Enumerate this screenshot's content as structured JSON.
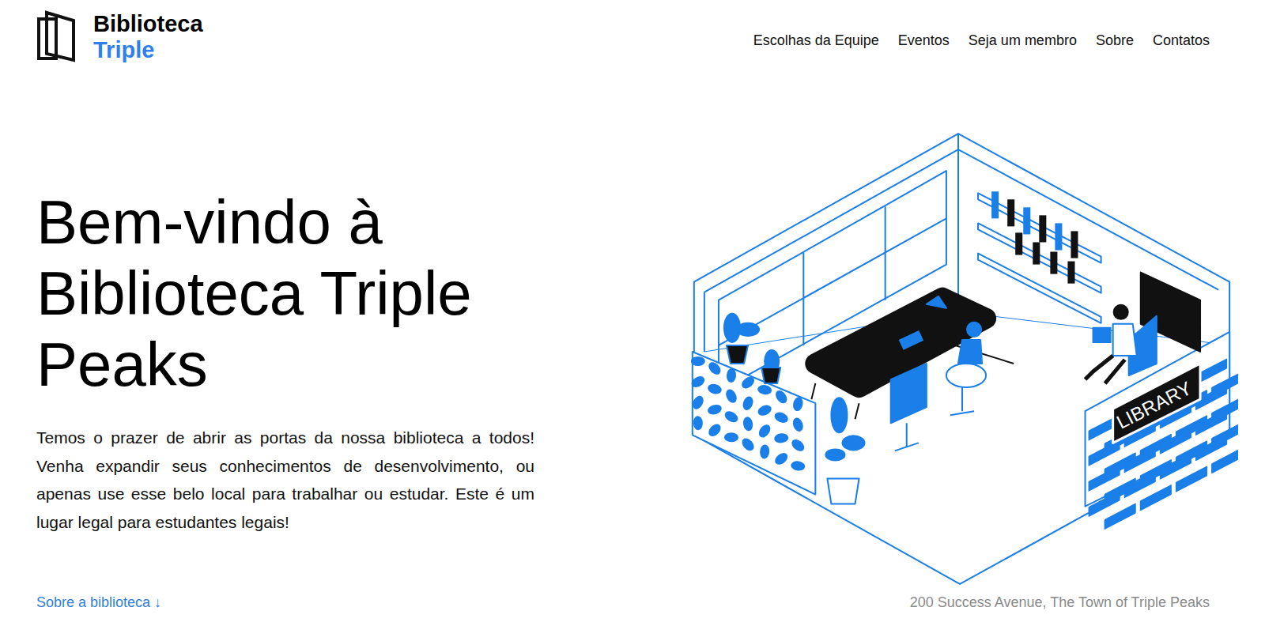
{
  "header": {
    "logo": {
      "line1": "Biblioteca",
      "line2": "Triple"
    },
    "nav": [
      "Escolhas da Equipe",
      "Eventos",
      "Seja um membro",
      "Sobre",
      "Contatos"
    ]
  },
  "hero": {
    "title": "Bem-vindo à Biblioteca Triple Peaks",
    "text": "Temos o prazer de abrir as portas da nossa biblioteca a todos! Venha expandir seus conhecimentos de desenvolvimento, ou apenas use esse belo local para trabalhar ou estudar. Este é um lugar legal para estudantes legais!",
    "link": "Sobre a biblioteca ↓",
    "address": "200 Success Avenue, The Town of Triple Peaks"
  },
  "illustration": {
    "sign": "LIBRARY",
    "thought": "??"
  }
}
